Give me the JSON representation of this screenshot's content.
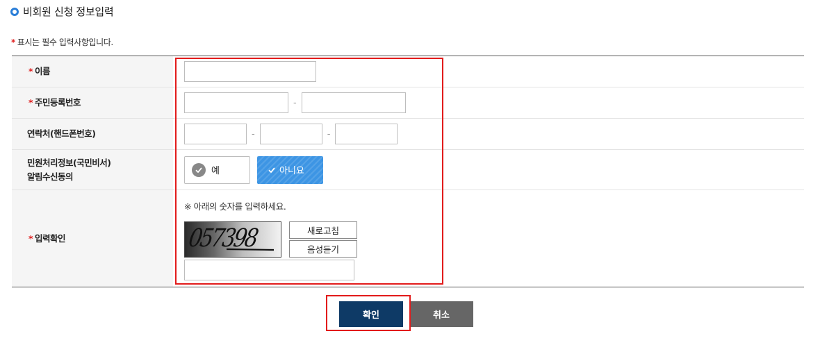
{
  "section_title": "비회원 신청 정보입력",
  "required_note": {
    "star": "*",
    "text": "표시는 필수 입력사항입니다."
  },
  "fields": {
    "name": {
      "star": "*",
      "label": "이름",
      "value": ""
    },
    "resident_number": {
      "star": "*",
      "label": "주민등록번호",
      "part1": "",
      "part2": "",
      "separator": "-"
    },
    "phone": {
      "label": "연락처(핸드폰번호)",
      "part1": "",
      "part2": "",
      "part3": "",
      "separator": "-"
    },
    "consent": {
      "label_line1": "민원처리정보(국민비서)",
      "label_line2": "알림수신동의",
      "yes_label": "예",
      "no_label": "아니요",
      "selected": "아니요"
    },
    "captcha": {
      "star": "*",
      "label": "입력확인",
      "note": "※ 아래의 숫자를 입력하세요.",
      "image_text": "057398",
      "refresh_label": "새로고침",
      "audio_label": "음성듣기",
      "value": ""
    }
  },
  "buttons": {
    "confirm": "확인",
    "cancel": "취소"
  },
  "colors": {
    "accent_blue": "#3d95e4",
    "confirm_navy": "#0e3a66",
    "required_red": "#e02020",
    "highlight_red": "#e21b1b"
  }
}
